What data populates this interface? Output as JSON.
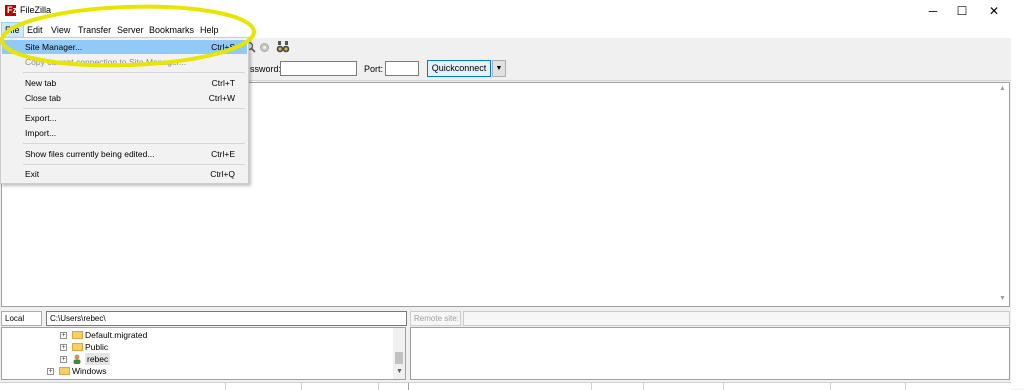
{
  "window": {
    "title": "FileZilla",
    "controls": {
      "minimize": "─",
      "maximize": "☐",
      "close": "✕"
    }
  },
  "menubar": [
    "File",
    "Edit",
    "View",
    "Transfer",
    "Server",
    "Bookmarks",
    "Help"
  ],
  "file_menu": {
    "items": [
      {
        "label": "Site Manager...",
        "shortcut": "Ctrl+S",
        "highlighted": true
      },
      {
        "label": "Copy current connection to Site Manager...",
        "shortcut": "",
        "disabled": true
      },
      {
        "label": "New tab",
        "shortcut": "Ctrl+T"
      },
      {
        "label": "Close tab",
        "shortcut": "Ctrl+W"
      },
      {
        "label": "Export...",
        "shortcut": ""
      },
      {
        "label": "Import...",
        "shortcut": ""
      },
      {
        "label": "Show files currently being edited...",
        "shortcut": "Ctrl+E"
      },
      {
        "label": "Exit",
        "shortcut": "Ctrl+Q"
      }
    ]
  },
  "quickconnect": {
    "password_label": "ssword:",
    "password_value": "",
    "port_label": "Port:",
    "port_value": "",
    "button_label": "Quickconnect",
    "dropdown_arrow": "▼"
  },
  "local": {
    "label": "Local site:",
    "path": "C:\\Users\\rebec\\",
    "tree": [
      {
        "name": "Default.migrated",
        "icon": "folder-icon"
      },
      {
        "name": "Public",
        "icon": "folder-icon"
      },
      {
        "name": "rebec",
        "icon": "user-folder-icon",
        "selected": true
      },
      {
        "name": "Windows",
        "icon": "folder-icon"
      }
    ]
  },
  "remote": {
    "label": "Remote site:",
    "path": ""
  },
  "colors": {
    "highlight_ellipse": "#e6e600",
    "menu_highlight": "#91c9f7",
    "quickconnect_border": "#0078d7"
  }
}
